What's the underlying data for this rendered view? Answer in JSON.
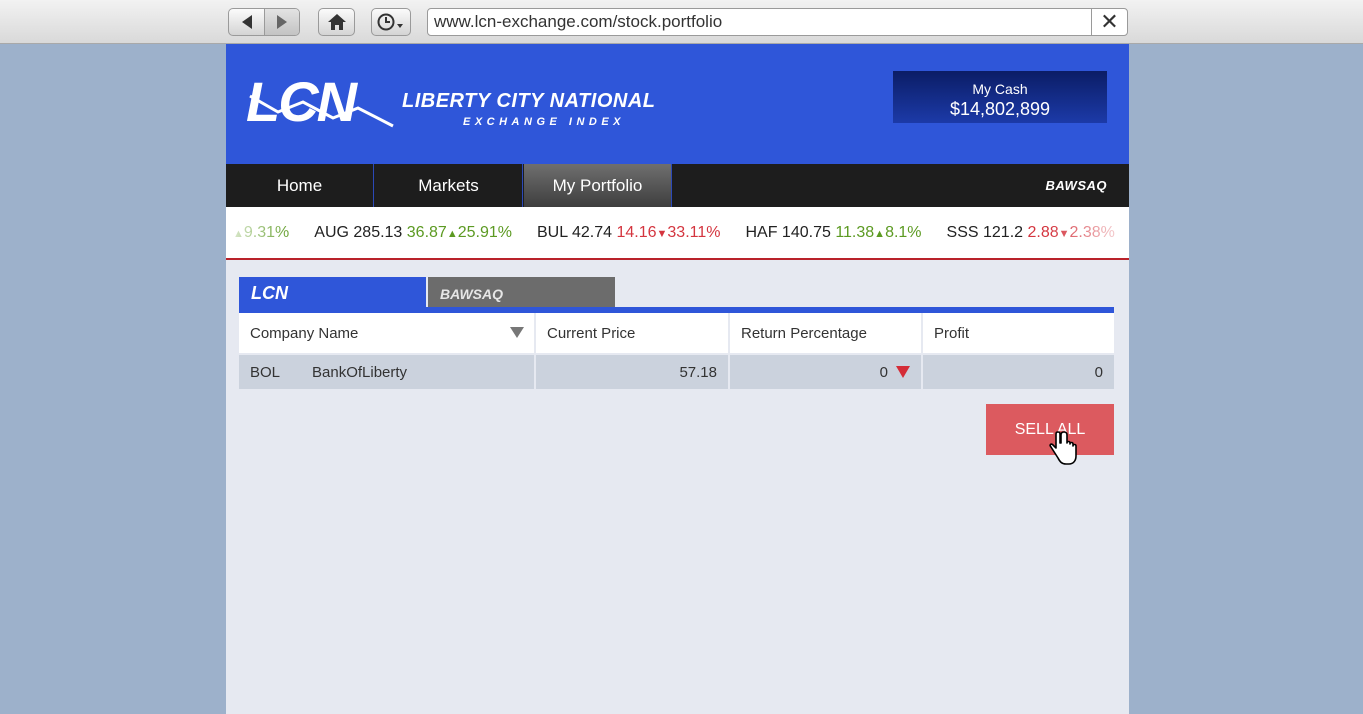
{
  "browser": {
    "url": "www.lcn-exchange.com/stock.portfolio",
    "icons": [
      "back-icon",
      "forward-icon",
      "home-icon",
      "history-icon",
      "close-icon"
    ]
  },
  "header": {
    "logo_text": "LCN",
    "brand_title": "LIBERTY CITY NATIONAL",
    "brand_subtitle": "EXCHANGE INDEX",
    "cash_label": "My Cash",
    "cash_value": "$14,802,899"
  },
  "nav": {
    "items": [
      "Home",
      "Markets",
      "My Portfolio"
    ],
    "active": "My Portfolio",
    "partner": "BAWSAQ"
  },
  "ticker": [
    {
      "symbol": "",
      "price": "",
      "change": "",
      "pct": "9.31%",
      "dir": "up"
    },
    {
      "symbol": "AUG",
      "price": "285.13",
      "change": "36.87",
      "pct": "25.91%",
      "dir": "up"
    },
    {
      "symbol": "BUL",
      "price": "42.74",
      "change": "14.16",
      "pct": "33.11%",
      "dir": "down"
    },
    {
      "symbol": "HAF",
      "price": "140.75",
      "change": "11.38",
      "pct": "8.1%",
      "dir": "up"
    },
    {
      "symbol": "SSS",
      "price": "121.2",
      "change": "2.88",
      "pct": "2.38%",
      "dir": "down"
    }
  ],
  "tabs": {
    "lcn": "LCN",
    "bawsaq": "BAWSAQ"
  },
  "table": {
    "headers": [
      "Company Name",
      "Current Price",
      "Return Percentage",
      "Profit"
    ],
    "rows": [
      {
        "symbol": "BOL",
        "name": "BankOfLiberty",
        "price": "57.18",
        "return_pct": "0",
        "profit": "0"
      }
    ]
  },
  "actions": {
    "sell_all": "SELL ALL"
  },
  "colors": {
    "brand_blue": "#2f56d9",
    "nav_dark": "#1d1d1d",
    "up_green": "#5c9a22",
    "down_red": "#d4353f",
    "sell_button": "#dc5a5f"
  }
}
